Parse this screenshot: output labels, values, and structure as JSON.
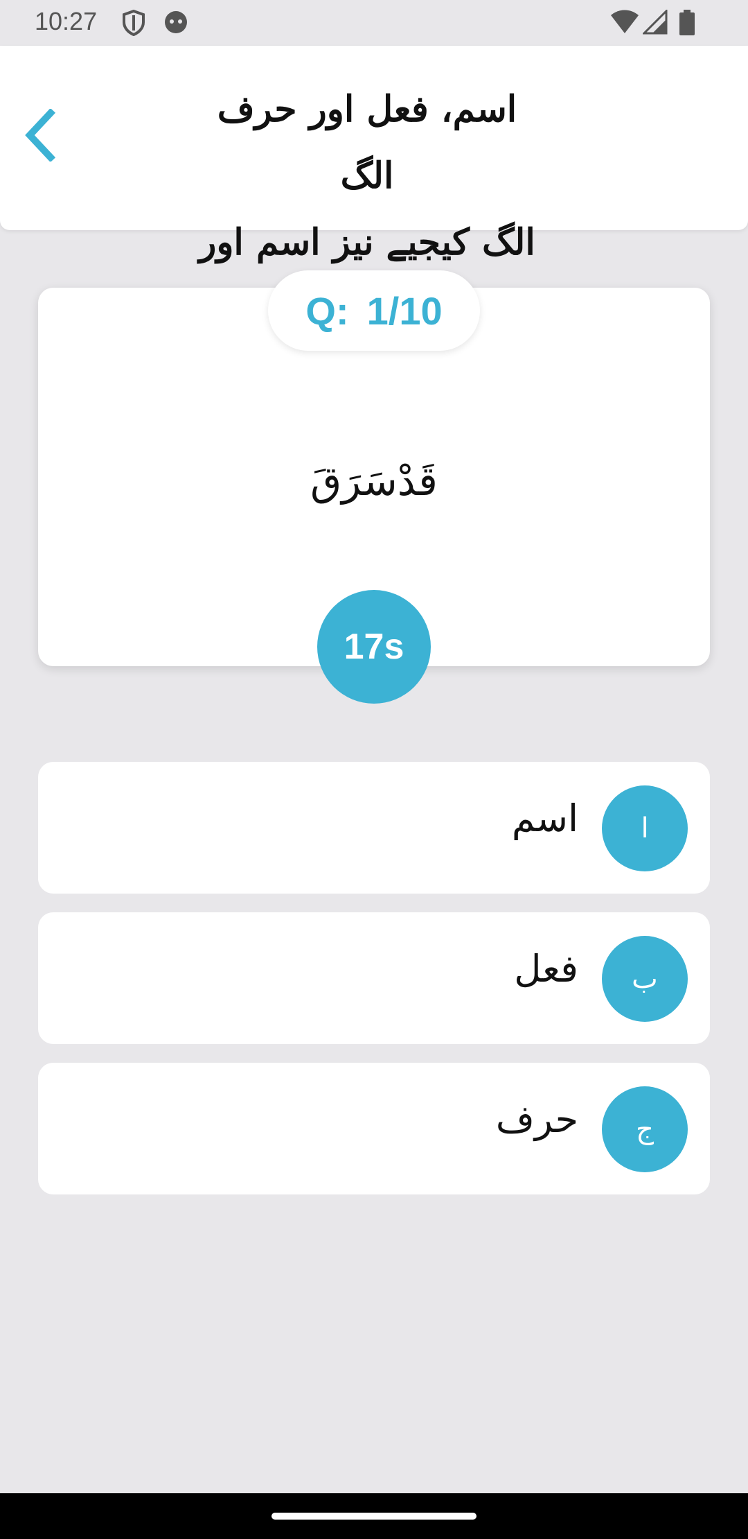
{
  "status_bar": {
    "time": "10:27",
    "icons": [
      "shield-icon",
      "robot-icon",
      "wifi-icon",
      "signal-icon",
      "battery-icon"
    ]
  },
  "header": {
    "back_icon": "chevron-left-icon",
    "title_line1": "اسم، فعل اور حرف الگ",
    "title_line2": "الگ کیجیے نیز اسم اور ..."
  },
  "question": {
    "label": "Q:",
    "progress": "1/10",
    "text": "قَدْسَرَقَ",
    "timer": "17s"
  },
  "options": [
    {
      "badge": "ا",
      "text": "اسم"
    },
    {
      "badge": "ب",
      "text": "فعل"
    },
    {
      "badge": "ج",
      "text": "حرف"
    }
  ],
  "colors": {
    "accent": "#3cb2d4",
    "background": "#e8e7ea",
    "card": "#ffffff"
  }
}
